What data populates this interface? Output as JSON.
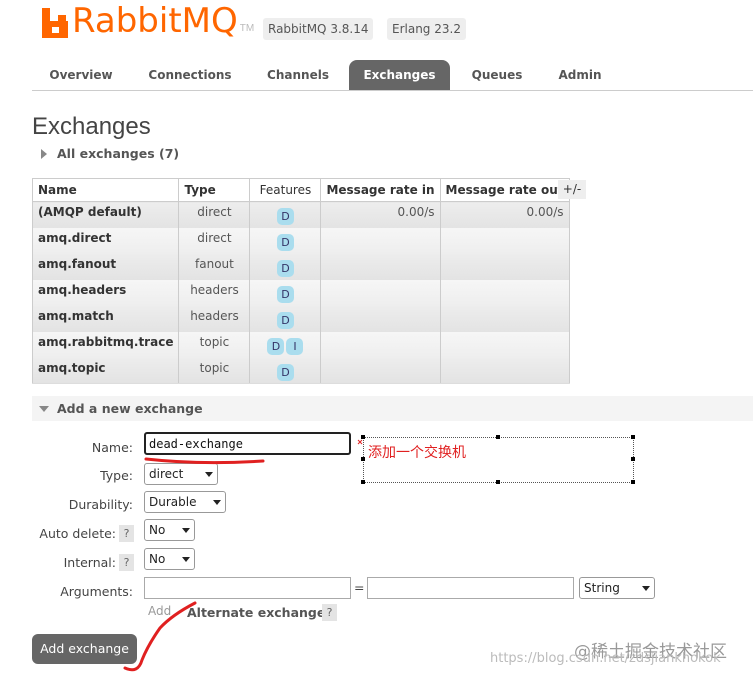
{
  "header": {
    "brand": "RabbitMQ",
    "tm": "TM",
    "rabbitmq_version": "RabbitMQ 3.8.14",
    "erlang_version": "Erlang 23.2"
  },
  "nav": {
    "tabs": [
      {
        "label": "Overview"
      },
      {
        "label": "Connections"
      },
      {
        "label": "Channels"
      },
      {
        "label": "Exchanges",
        "active": true
      },
      {
        "label": "Queues"
      },
      {
        "label": "Admin"
      }
    ]
  },
  "page": {
    "title": "Exchanges",
    "all_exchanges_label": "All exchanges (7)"
  },
  "table": {
    "headers": {
      "name": "Name",
      "type": "Type",
      "features": "Features",
      "rate_in": "Message rate in",
      "rate_out": "Message rate out"
    },
    "col_toggle": "+/-",
    "rows": [
      {
        "name": "(AMQP default)",
        "type": "direct",
        "features": [
          "D"
        ],
        "rate_in": "0.00/s",
        "rate_out": "0.00/s"
      },
      {
        "name": "amq.direct",
        "type": "direct",
        "features": [
          "D"
        ],
        "rate_in": "",
        "rate_out": ""
      },
      {
        "name": "amq.fanout",
        "type": "fanout",
        "features": [
          "D"
        ],
        "rate_in": "",
        "rate_out": ""
      },
      {
        "name": "amq.headers",
        "type": "headers",
        "features": [
          "D"
        ],
        "rate_in": "",
        "rate_out": ""
      },
      {
        "name": "amq.match",
        "type": "headers",
        "features": [
          "D"
        ],
        "rate_in": "",
        "rate_out": ""
      },
      {
        "name": "amq.rabbitmq.trace",
        "type": "topic",
        "features": [
          "D",
          "I"
        ],
        "rate_in": "",
        "rate_out": ""
      },
      {
        "name": "amq.topic",
        "type": "topic",
        "features": [
          "D"
        ],
        "rate_in": "",
        "rate_out": ""
      }
    ]
  },
  "add_exchange": {
    "section_label": "Add a new exchange",
    "name_label": "Name:",
    "name_value": "dead-exchange",
    "type_label": "Type:",
    "type_value": "direct",
    "durability_label": "Durability:",
    "durability_value": "Durable",
    "auto_delete_label": "Auto delete:",
    "auto_delete_value": "No",
    "internal_label": "Internal:",
    "internal_value": "No",
    "help": "?",
    "arguments_label": "Arguments:",
    "arg_key_value": "",
    "equals": "=",
    "arg_value_value": "",
    "arg_type_value": "String",
    "add_link": "Add",
    "alternate_exchange": "Alternate exchange",
    "submit_label": "Add exchange"
  },
  "annotation": {
    "note": "添加一个交换机",
    "color": "#e02020"
  },
  "watermark": {
    "brand": "@稀土掘金技术社区",
    "url": "https://blog.csdn.net/zdsjiankhokok"
  },
  "colors": {
    "brand_orange": "#ff6600",
    "active_tab": "#666666",
    "feature_badge": "#aaddee"
  }
}
